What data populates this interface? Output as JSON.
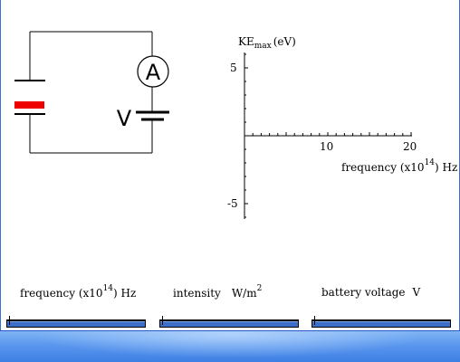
{
  "graph": {
    "y_label": "KE",
    "y_label_sub": "max",
    "y_label_unit": "(eV)",
    "y_ticks": [
      "5",
      "-5"
    ],
    "x_ticks": [
      "10",
      "20"
    ],
    "x_label_text": "frequency (x10",
    "x_label_exp": "14",
    "x_label_unit": ") Hz"
  },
  "circuit": {
    "ammeter_label": "A",
    "voltage_label": "V",
    "plate_color": "#ee0000"
  },
  "controls": {
    "frequency": {
      "label_text": "frequency (x10",
      "label_exp": "14",
      "label_unit": ") Hz"
    },
    "intensity": {
      "label_text": "intensity",
      "label_unit": "W/m",
      "label_exp": "2"
    },
    "voltage": {
      "label_text": "battery voltage",
      "label_unit": "V"
    }
  }
}
